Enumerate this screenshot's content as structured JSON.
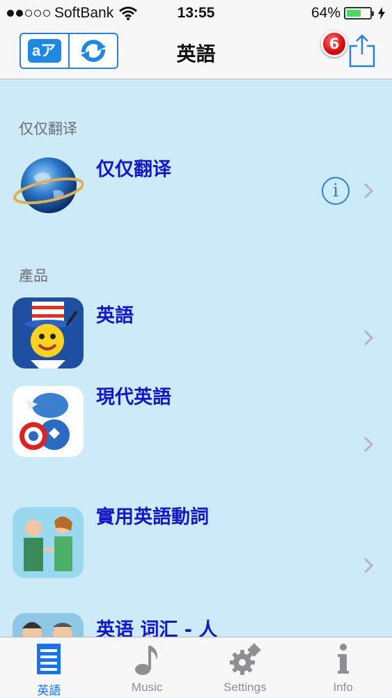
{
  "status_bar": {
    "carrier": "SoftBank",
    "time": "13:55",
    "battery": "64%",
    "battery_level": 0.64
  },
  "navbar": {
    "title": "英語",
    "badge_count": "6",
    "translate_icon_text": "aア"
  },
  "sections": [
    {
      "header": "仅仅翻译",
      "items": [
        {
          "title": "仅仅翻译"
        }
      ]
    },
    {
      "header": "產品",
      "items": [
        {
          "title": "英語"
        },
        {
          "title": "現代英語"
        },
        {
          "title": "實用英語動詞"
        },
        {
          "title": "英语 词汇 - 人"
        }
      ]
    }
  ],
  "tabbar": {
    "tabs": [
      {
        "label": "英語",
        "icon": "list-icon",
        "active": true
      },
      {
        "label": "Music",
        "icon": "music-note-icon"
      },
      {
        "label": "Settings",
        "icon": "gear-icon"
      },
      {
        "label": "Info",
        "icon": "info-icon"
      }
    ]
  },
  "colors": {
    "accent": "#2a7fe0",
    "title_blue": "#1616c8",
    "background": "#cdeaf8",
    "badge_red": "#d9070b"
  }
}
